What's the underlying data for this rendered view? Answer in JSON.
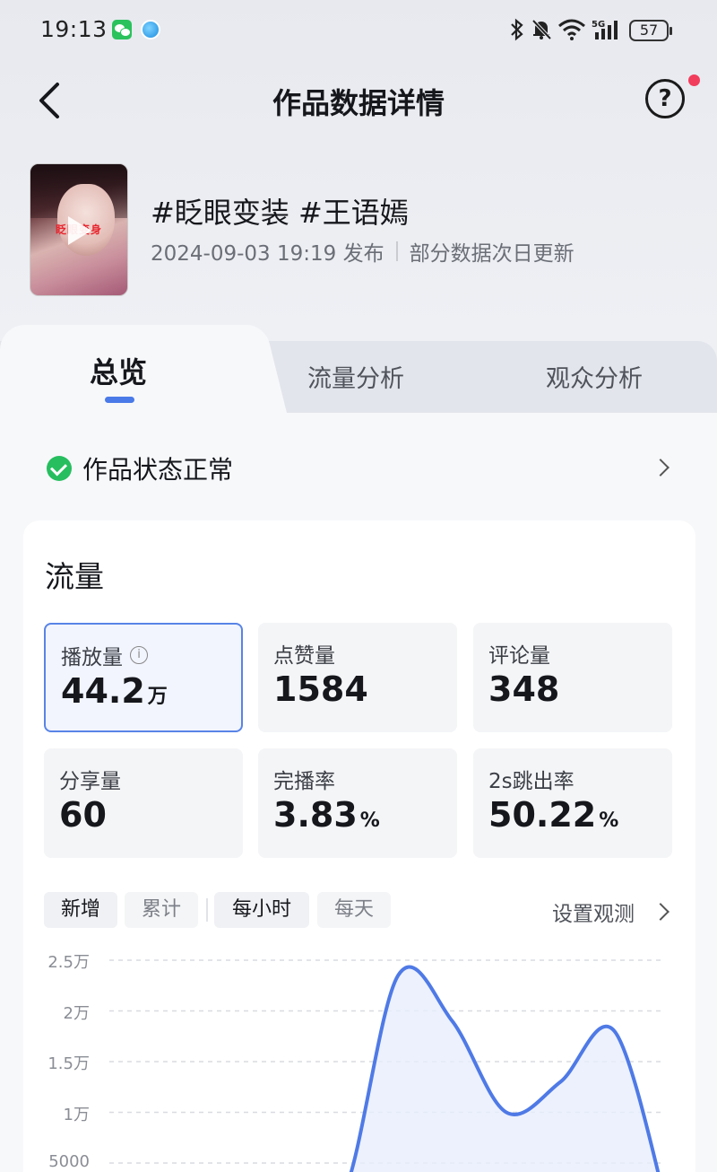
{
  "status_bar": {
    "time": "19:13",
    "battery": "57"
  },
  "header": {
    "title": "作品数据详情"
  },
  "video": {
    "title": "#眨眼变装 #王语嫣",
    "published": "2024-09-03 19:19 发布",
    "update_note": "部分数据次日更新",
    "thumb_text": "眨眼变身"
  },
  "tabs": [
    {
      "label": "总览",
      "active": true
    },
    {
      "label": "流量分析",
      "active": false
    },
    {
      "label": "观众分析",
      "active": false
    }
  ],
  "work_status": "作品状态正常",
  "traffic": {
    "title": "流量",
    "metrics": [
      {
        "label": "播放量",
        "value": "44.2",
        "unit": "万",
        "selected": true
      },
      {
        "label": "点赞量",
        "value": "1584",
        "unit": ""
      },
      {
        "label": "评论量",
        "value": "348",
        "unit": ""
      },
      {
        "label": "分享量",
        "value": "60",
        "unit": ""
      },
      {
        "label": "完播率",
        "value": "3.83",
        "unit": "%"
      },
      {
        "label": "2s跳出率",
        "value": "50.22",
        "unit": "%"
      }
    ],
    "toggles": {
      "mode": [
        {
          "label": "新增",
          "active": true
        },
        {
          "label": "累计",
          "active": false
        }
      ],
      "period": [
        {
          "label": "每小时",
          "active": true
        },
        {
          "label": "每天",
          "active": false
        }
      ]
    },
    "observe_link": "设置观测"
  },
  "chart_data": {
    "type": "area",
    "y_ticks": [
      "2.5万",
      "2万",
      "1.5万",
      "1万",
      "5000"
    ],
    "ylim": [
      0,
      25000
    ],
    "grid": true,
    "series": [
      {
        "values": [
          0,
          1500,
          0,
          0,
          0,
          2000,
          23500,
          19000,
          10000,
          13000,
          18000,
          0
        ]
      }
    ],
    "colors": {
      "line": "#4f7ae6",
      "fill": "#e7edfd"
    }
  }
}
